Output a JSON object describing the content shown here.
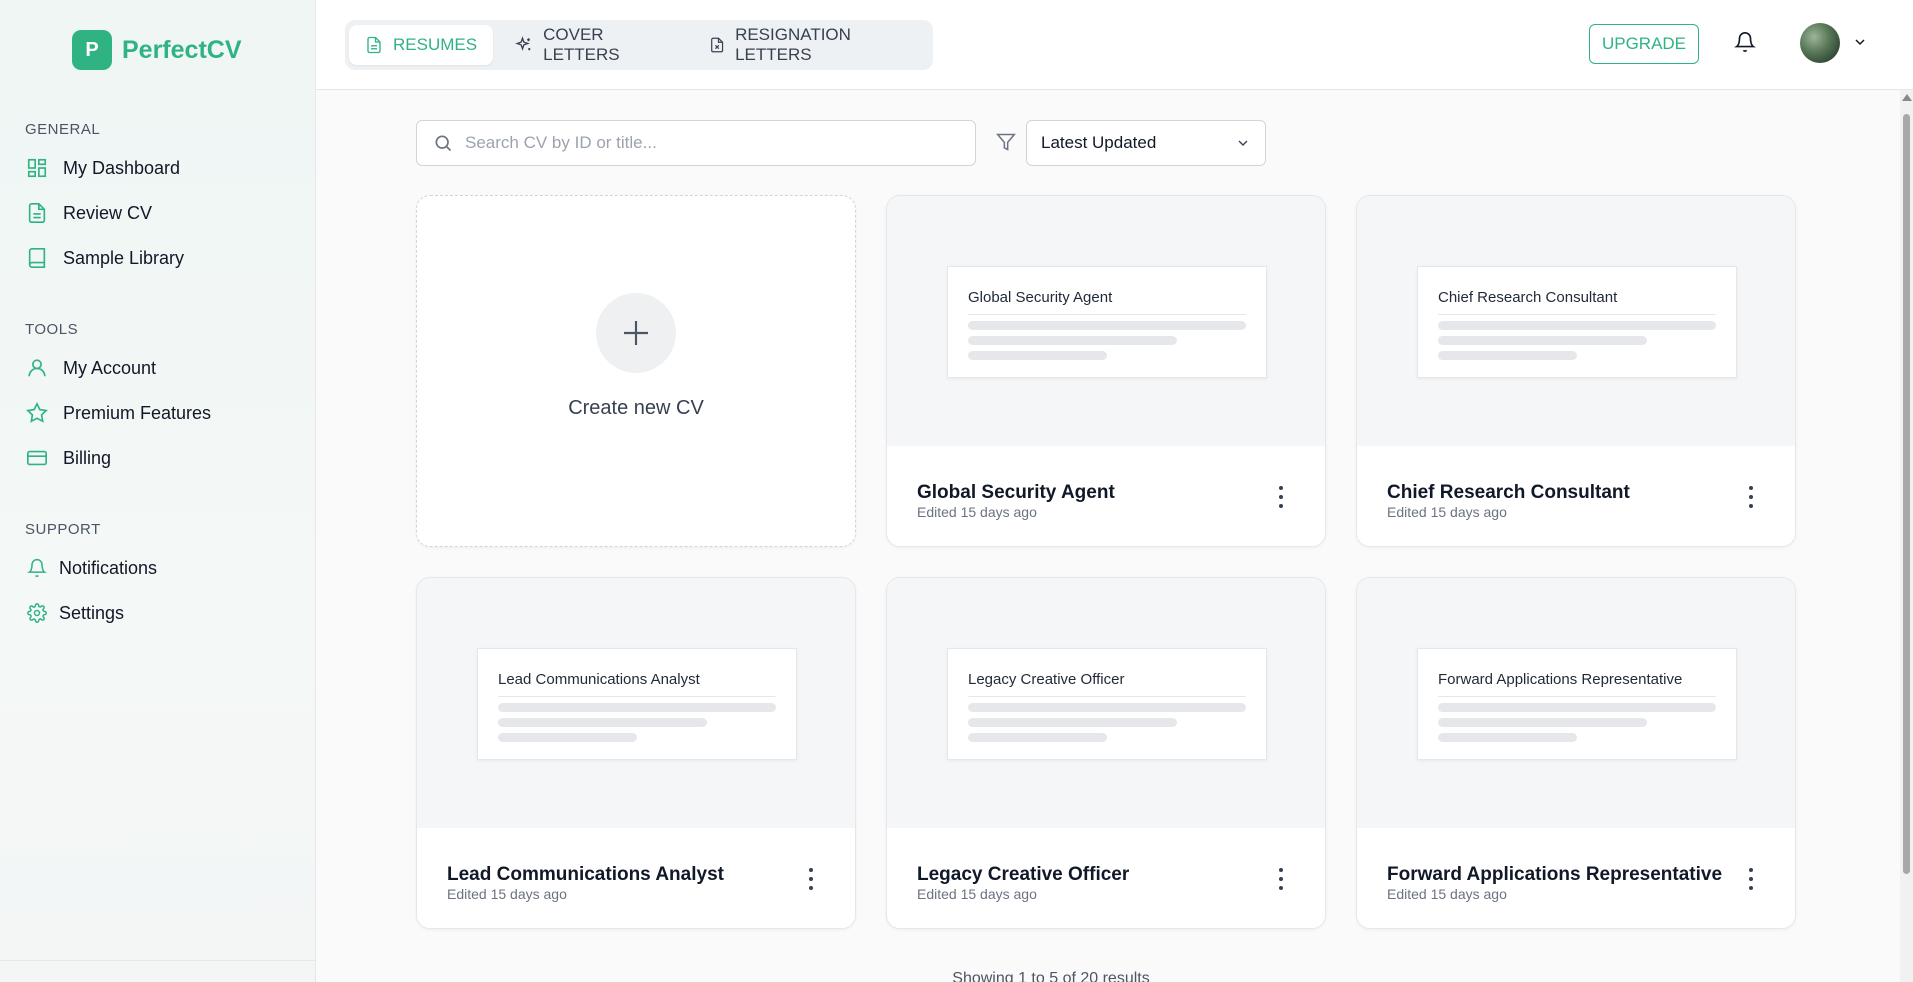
{
  "brand": {
    "logo_letter": "P",
    "name": "PerfectCV"
  },
  "sidebar": {
    "sections": [
      {
        "title": "GENERAL",
        "items": [
          {
            "label": "My Dashboard",
            "icon": "dashboard-icon"
          },
          {
            "label": "Review CV",
            "icon": "document-icon"
          },
          {
            "label": "Sample Library",
            "icon": "book-icon"
          }
        ]
      },
      {
        "title": "TOOLS",
        "items": [
          {
            "label": "My Account",
            "icon": "user-icon"
          },
          {
            "label": "Premium Features",
            "icon": "star-icon"
          },
          {
            "label": "Billing",
            "icon": "credit-card-icon"
          }
        ]
      },
      {
        "title": "SUPPORT",
        "items": [
          {
            "label": "Notifications",
            "icon": "bell-icon"
          },
          {
            "label": "Settings",
            "icon": "gear-icon"
          }
        ]
      }
    ]
  },
  "header": {
    "tabs": [
      {
        "label": "RESUMES",
        "icon": "document-icon",
        "active": true
      },
      {
        "label": "COVER LETTERS",
        "icon": "sparkle-icon",
        "active": false
      },
      {
        "label": "RESIGNATION LETTERS",
        "icon": "file-x-icon",
        "active": false
      }
    ],
    "upgrade_label": "UPGRADE"
  },
  "toolbar": {
    "search_placeholder": "Search CV by ID or title...",
    "sort_value": "Latest Updated"
  },
  "create_card": {
    "label": "Create new CV"
  },
  "cvs": [
    {
      "title": "Global Security Agent",
      "edited": "Edited 15 days ago"
    },
    {
      "title": "Chief Research Consultant",
      "edited": "Edited 15 days ago"
    },
    {
      "title": "Lead Communications Analyst",
      "edited": "Edited 15 days ago"
    },
    {
      "title": "Legacy Creative Officer",
      "edited": "Edited 15 days ago"
    },
    {
      "title": "Forward Applications Representative",
      "edited": "Edited 15 days ago"
    }
  ],
  "pagination": {
    "summary": "Showing 1 to 5 of 20 results"
  },
  "colors": {
    "accent": "#2fb382"
  }
}
